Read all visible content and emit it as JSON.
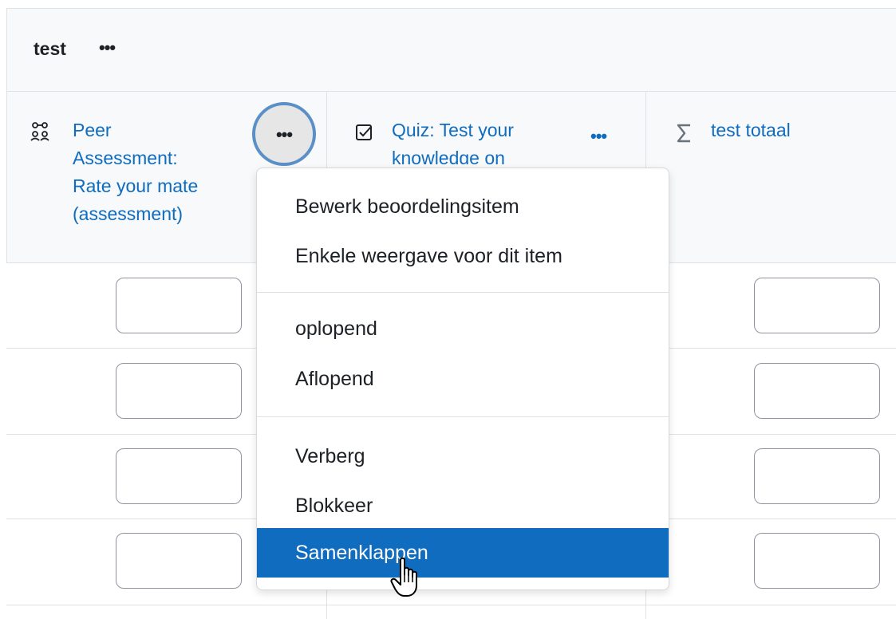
{
  "category": {
    "name": "test",
    "menu_glyph": "•••"
  },
  "columns": [
    {
      "icon": "peer-assessment-icon",
      "icon_glyph": "⚗",
      "title_lines": [
        "Peer",
        "Assessment:",
        "Rate your mate",
        "(assessment)"
      ],
      "menu_glyph": "•••"
    },
    {
      "icon": "quiz-checkbox-icon",
      "icon_glyph": "☑",
      "title_lines": [
        "Quiz: Test your",
        "knowledge on"
      ],
      "menu_glyph": "•••"
    },
    {
      "icon": "sigma-total-icon",
      "icon_glyph": "Σ",
      "title_lines": [
        "test totaal"
      ]
    }
  ],
  "dropdown": {
    "items": [
      "Bewerk beoordelingsitem",
      "Enkele weergave voor dit item",
      "oplopend",
      "Aflopend",
      "Verberg",
      "Blokkeer",
      "Samenklappen"
    ],
    "active_item": "Samenklappen"
  },
  "colors": {
    "link": "#0f6cbf",
    "active_bg": "#0f6cbf",
    "header_bg": "#f8f9fa",
    "focus_ring": "#5b8fc7"
  }
}
